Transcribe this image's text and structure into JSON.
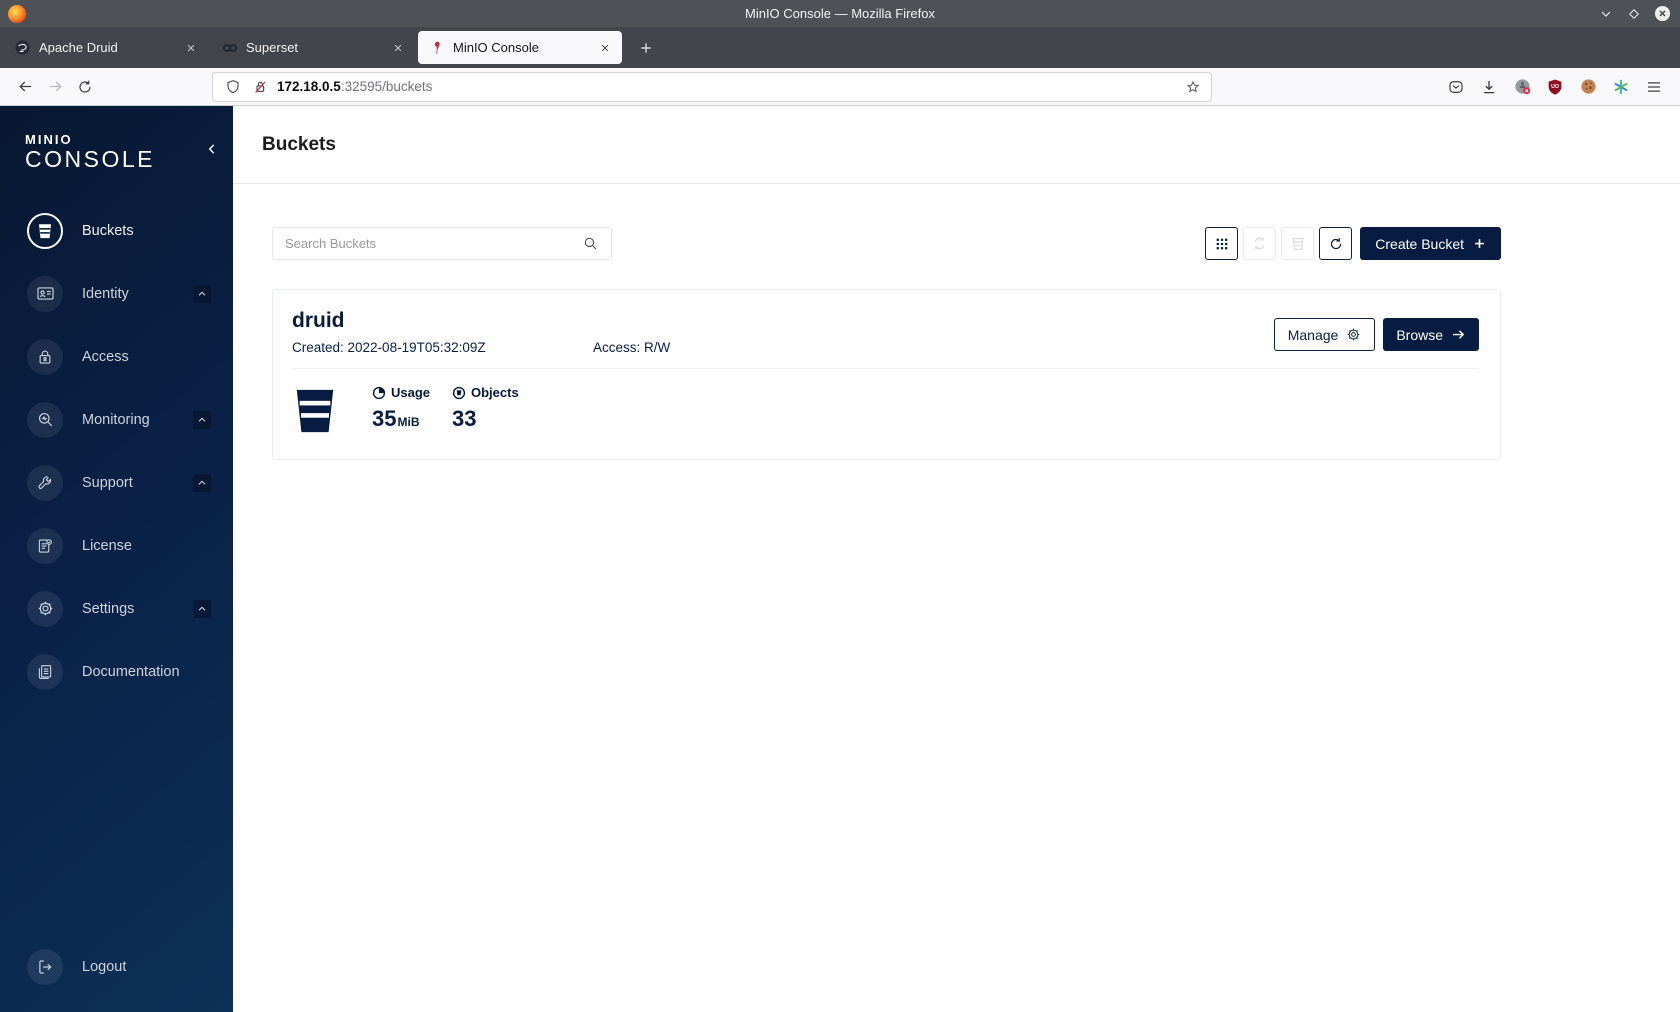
{
  "window": {
    "title": "MinIO Console — Mozilla Firefox"
  },
  "browser": {
    "tabs": [
      {
        "label": "Apache Druid",
        "icon": "druid-favicon",
        "active": false
      },
      {
        "label": "Superset",
        "icon": "superset-favicon",
        "active": false
      },
      {
        "label": "MinIO Console",
        "icon": "minio-favicon",
        "active": true
      }
    ],
    "url": {
      "host": "172.18.0.5",
      "rest": ":32595/buckets"
    }
  },
  "sidebar": {
    "logo_line1": "MINIO",
    "logo_line2": "CONSOLE",
    "items": [
      {
        "label": "Buckets",
        "icon": "bucket-icon",
        "active": true
      },
      {
        "label": "Identity",
        "icon": "identity-card-icon"
      },
      {
        "label": "Access",
        "icon": "lock-icon"
      },
      {
        "label": "Monitoring",
        "icon": "magnifier-icon"
      },
      {
        "label": "Support",
        "icon": "wrench-icon"
      },
      {
        "label": "License",
        "icon": "license-doc-icon"
      },
      {
        "label": "Settings",
        "icon": "gear-icon"
      },
      {
        "label": "Documentation",
        "icon": "book-icon"
      }
    ],
    "logout_label": "Logout"
  },
  "main": {
    "page_title": "Buckets",
    "search_placeholder": "Search Buckets",
    "create_label": "Create Bucket",
    "buckets": [
      {
        "name": "druid",
        "created_label": "Created: 2022-08-19T05:32:09Z",
        "access_label": "Access: R/W",
        "manage_label": "Manage",
        "browse_label": "Browse",
        "usage_label": "Usage",
        "usage_value": "35",
        "usage_unit": "MiB",
        "objects_label": "Objects",
        "objects_value": "33"
      }
    ]
  },
  "colors": {
    "accent_navy": "#081C42",
    "minio_red": "#C72C48"
  }
}
